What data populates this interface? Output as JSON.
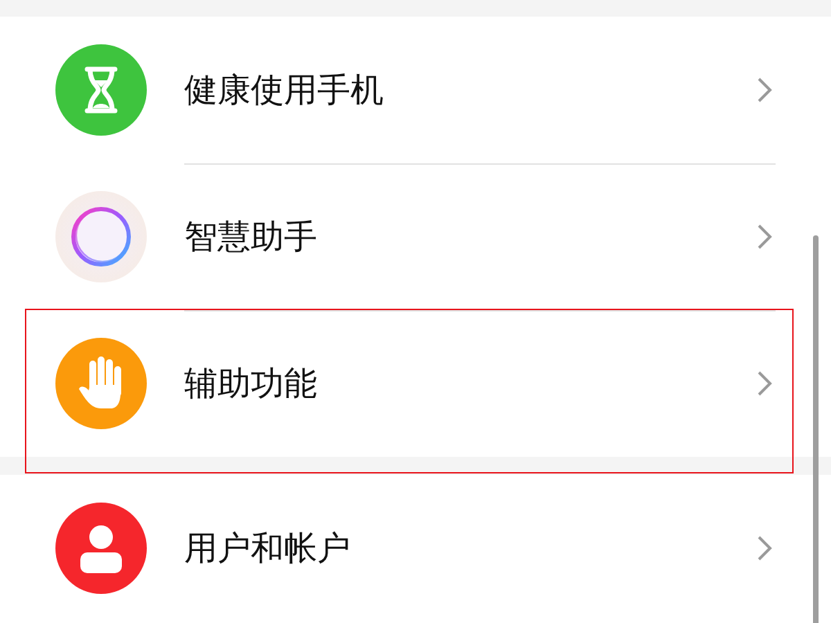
{
  "groups": [
    {
      "items": [
        {
          "label": "健康使用手机",
          "kind": "hourglass",
          "highlighted": false
        },
        {
          "label": "智慧助手",
          "kind": "assistant",
          "highlighted": false
        },
        {
          "label": "辅助功能",
          "kind": "hand",
          "highlighted": true
        }
      ]
    },
    {
      "items": [
        {
          "label": "用户和帐户",
          "kind": "person",
          "highlighted": false
        }
      ]
    }
  ]
}
